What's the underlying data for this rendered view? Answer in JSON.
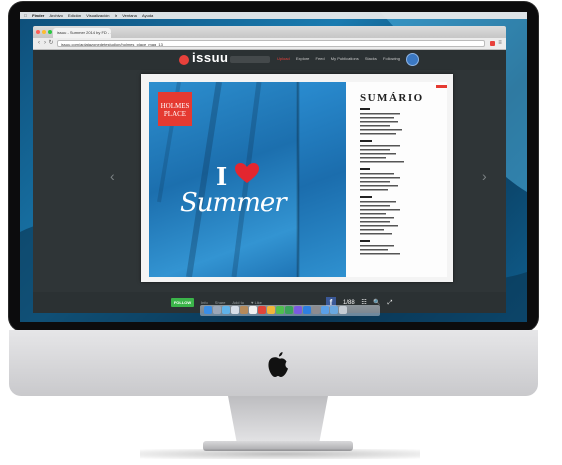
{
  "menubar": {
    "items": [
      "Finder",
      "Archivo",
      "Edición",
      "Visualización",
      "Ir",
      "Ventana",
      "Ayuda"
    ]
  },
  "browser": {
    "tab_title": "issuu - Summer 2014 by FD - ...",
    "url": "issuu.com/aplatazonedetestudion/holmes_place_mag_13"
  },
  "issuu": {
    "logo": "issuu",
    "nav": [
      "Upload",
      "Explore",
      "Feed",
      "My Publications",
      "Stacks",
      "Following"
    ]
  },
  "magazine": {
    "brand_logo": "HOLMES PLACE",
    "cover_prefix": "I",
    "cover_word": "Summer",
    "toc_title": "SUMÁRIO"
  },
  "bottom": {
    "follow_label": "FOLLOW",
    "actions": [
      "Info",
      "Share",
      "Add to",
      "♥ Like"
    ],
    "facebook": "f",
    "tools": [
      "1/88",
      "☷",
      "🔍",
      "⤢"
    ]
  },
  "colors": {
    "issuu_red": "#e8413b",
    "follow_green": "#3bb54a",
    "brand_red": "#e53a31",
    "facebook_blue": "#3b5998"
  }
}
